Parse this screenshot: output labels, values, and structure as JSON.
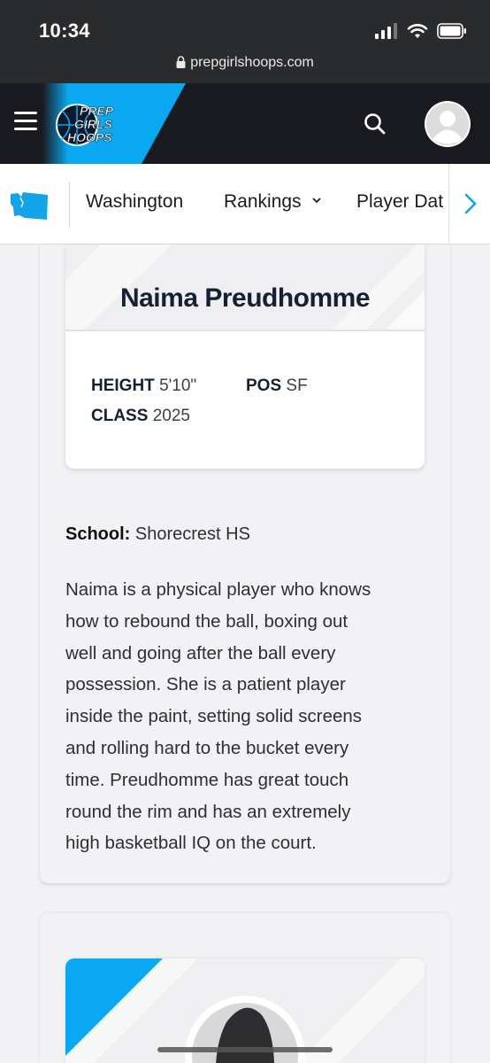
{
  "status_bar": {
    "time": "10:34",
    "url": "prepgirlshoops.com"
  },
  "header": {
    "logo_lines": [
      "PREP",
      "GIRLS",
      "HOOPS"
    ],
    "brand_color": "#0aa8f0"
  },
  "subnav": {
    "items": [
      {
        "label": "Washington"
      },
      {
        "label": "Rankings",
        "chevron": "chevron-down-icon"
      },
      {
        "label": "Player Dat"
      }
    ],
    "scroll_icon": "chevron-right-icon"
  },
  "player": {
    "name": "Naima Preudhomme",
    "stats": {
      "height_label": "HEIGHT",
      "height_value": "5'10\"",
      "pos_label": "POS",
      "pos_value": "SF",
      "class_label": "CLASS",
      "class_value": "2025"
    },
    "school_label": "School:",
    "school_value": "Shorecrest HS",
    "bio": [
      "Naima is a physical player who knows",
      "how to rebound the ball, boxing out",
      "well and going after the ball every",
      "possession. She is a patient player",
      "inside the paint, setting solid screens",
      "and rolling hard to the bucket every",
      "time. Preudhomme has great touch",
      "round the rim and has an extremely",
      "high basketball IQ on the court."
    ]
  }
}
